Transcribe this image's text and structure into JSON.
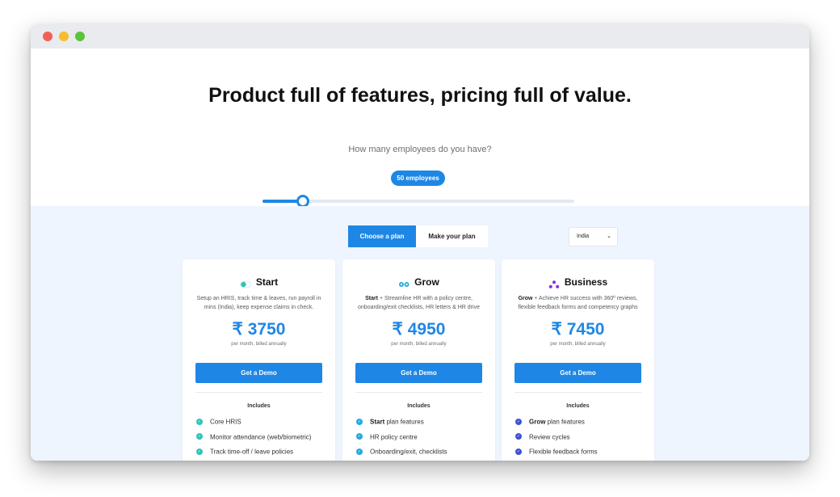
{
  "hero": {
    "title": "Product full of features, pricing full of value.",
    "question": "How many employees do you have?",
    "employees_badge": "50 employees",
    "slider_value_fraction": 0.13
  },
  "plans_nav": {
    "tab_choose": "Choose a plan",
    "tab_make": "Make your plan",
    "country": "India"
  },
  "cards": [
    {
      "name": "Start",
      "icon": "start-toggle-icon",
      "accent": "#2ec4b6",
      "desc_bold": "",
      "desc_rest": "Setup an HRIS, track time & leaves, run payroll in mins (India), keep expense claims in check.",
      "price": "₹ 3750",
      "billing": "per month, billed annually",
      "cta": "Get a Demo",
      "includes": "Includes",
      "features": [
        {
          "bold": "",
          "text": "Core HRIS"
        },
        {
          "bold": "",
          "text": "Monitor attendance (web/biometric)"
        },
        {
          "bold": "",
          "text": "Track time-off / leave policies"
        }
      ]
    },
    {
      "name": "Grow",
      "icon": "grow-dots-icon",
      "accent": "#25a9e0",
      "desc_bold": "Start",
      "desc_rest": " + Streamline HR with a policy centre, onboarding/exit checklists, HR letters & HR drive",
      "price": "₹ 4950",
      "billing": "per month, billed annually",
      "cta": "Get a Demo",
      "includes": "Includes",
      "features": [
        {
          "bold": "Start",
          "text": " plan features"
        },
        {
          "bold": "",
          "text": "HR policy centre"
        },
        {
          "bold": "",
          "text": "Onboarding/exit, checklists"
        }
      ]
    },
    {
      "name": "Business",
      "icon": "business-triangle-icon",
      "accent": "#3c4fd6",
      "desc_bold": "Grow",
      "desc_rest": " + Achieve HR success with 360º reviews, flexible feedback forms and competency graphs",
      "price": "₹ 7450",
      "billing": "per month, billed annually",
      "cta": "Get a Demo",
      "includes": "Includes",
      "features": [
        {
          "bold": "Grow",
          "text": " plan features"
        },
        {
          "bold": "",
          "text": "Review cycles"
        },
        {
          "bold": "",
          "text": "Flexible feedback forms"
        }
      ]
    }
  ],
  "colors": {
    "primary": "#1e87e5",
    "plans_bg": "#eef5fe",
    "business_icon": "#8a2be2"
  }
}
